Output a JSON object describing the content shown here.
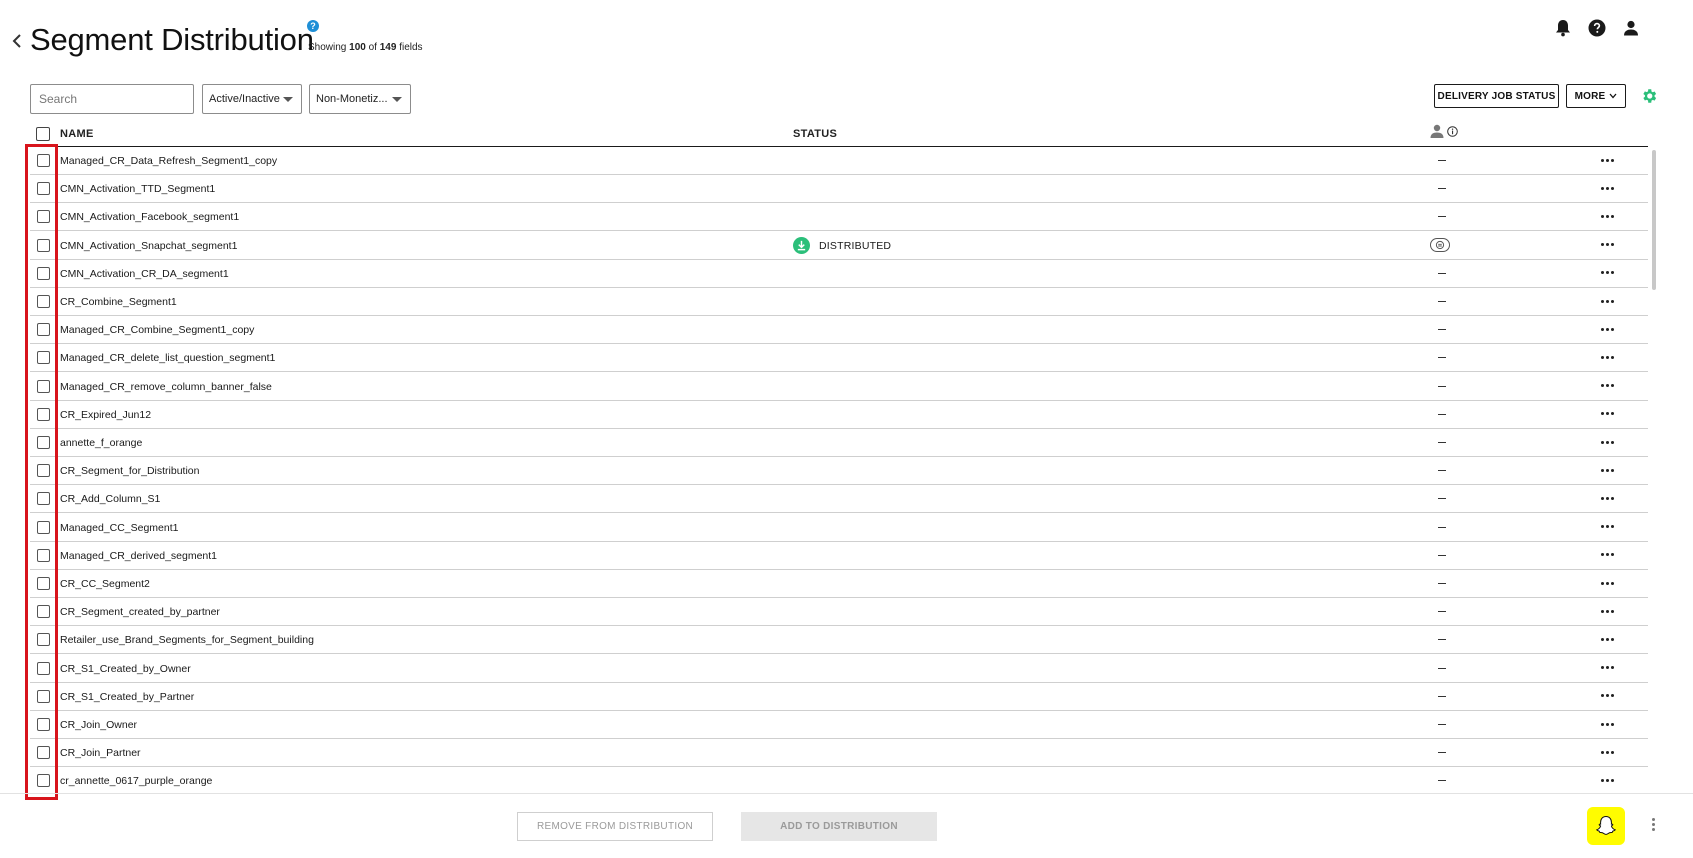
{
  "header": {
    "title": "Segment Distribution",
    "help_glyph": "?",
    "showing_prefix": "Showing",
    "showing_count": "100",
    "showing_of": "of",
    "showing_total": "149",
    "showing_suffix": "fields"
  },
  "toolbar": {
    "search_placeholder": "Search",
    "filter_status": "Active/Inactive",
    "filter_monetization": "Non-Monetiz...",
    "delivery_button": "DELIVERY JOB STATUS",
    "more_button": "MORE"
  },
  "table": {
    "col_name": "NAME",
    "col_status": "STATUS",
    "dash": "—",
    "rows": [
      {
        "name": "Managed_CR_Data_Refresh_Segment1_copy",
        "status": "",
        "special": false
      },
      {
        "name": "CMN_Activation_TTD_Segment1",
        "status": "",
        "special": false
      },
      {
        "name": "CMN_Activation_Facebook_segment1",
        "status": "",
        "special": false
      },
      {
        "name": "CMN_Activation_Snapchat_segment1",
        "status": "DISTRIBUTED",
        "special": true
      },
      {
        "name": "CMN_Activation_CR_DA_segment1",
        "status": "",
        "special": false
      },
      {
        "name": "CR_Combine_Segment1",
        "status": "",
        "special": false
      },
      {
        "name": "Managed_CR_Combine_Segment1_copy",
        "status": "",
        "special": false
      },
      {
        "name": "Managed_CR_delete_list_question_segment1",
        "status": "",
        "special": false
      },
      {
        "name": "Managed_CR_remove_column_banner_false",
        "status": "",
        "special": false
      },
      {
        "name": "CR_Expired_Jun12",
        "status": "",
        "special": false
      },
      {
        "name": "annette_f_orange",
        "status": "",
        "special": false
      },
      {
        "name": "CR_Segment_for_Distribution",
        "status": "",
        "special": false
      },
      {
        "name": "CR_Add_Column_S1",
        "status": "",
        "special": false
      },
      {
        "name": "Managed_CC_Segment1",
        "status": "",
        "special": false
      },
      {
        "name": "Managed_CR_derived_segment1",
        "status": "",
        "special": false
      },
      {
        "name": "CR_CC_Segment2",
        "status": "",
        "special": false
      },
      {
        "name": "CR_Segment_created_by_partner",
        "status": "",
        "special": false
      },
      {
        "name": "Retailer_use_Brand_Segments_for_Segment_building",
        "status": "",
        "special": false
      },
      {
        "name": "CR_S1_Created_by_Owner",
        "status": "",
        "special": false
      },
      {
        "name": "CR_S1_Created_by_Partner",
        "status": "",
        "special": false
      },
      {
        "name": "CR_Join_Owner",
        "status": "",
        "special": false
      },
      {
        "name": "CR_Join_Partner",
        "status": "",
        "special": false
      },
      {
        "name": "cr_annette_0617_purple_orange",
        "status": "",
        "special": false
      }
    ]
  },
  "footer": {
    "remove_button": "REMOVE FROM DISTRIBUTION",
    "add_button": "ADD TO DISTRIBUTION"
  },
  "colors": {
    "highlight": "#d8141c",
    "status_green": "#2bbf7a",
    "gear_green": "#2bbf7a",
    "snap_yellow": "#fffc00",
    "help_blue": "#1f8fd6"
  },
  "icons": {
    "back": "chevron-left-icon",
    "help": "help-circle-icon",
    "notifications": "bell-icon",
    "question": "question-circle-icon",
    "account": "user-icon",
    "settings": "gear-icon",
    "audience": "person-icon",
    "info": "info-icon",
    "distributed": "distributed-icon",
    "row_menu": "more-horizontal-icon",
    "brand": "snapchat-ghost-icon"
  }
}
